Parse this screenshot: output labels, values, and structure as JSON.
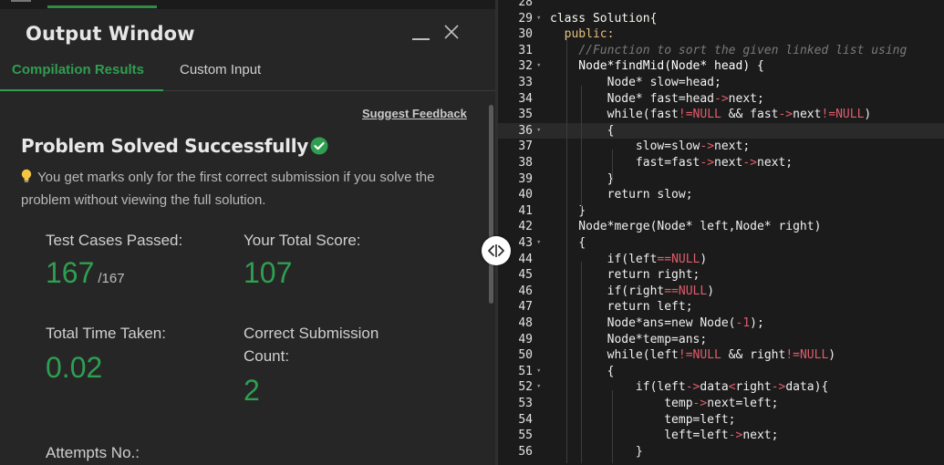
{
  "output": {
    "title": "Output Window",
    "tabs": [
      {
        "label": "Compilation Results",
        "active": true
      },
      {
        "label": "Custom Input",
        "active": false
      }
    ],
    "suggest_feedback": "Suggest Feedback",
    "status_title": "Problem Solved Successfully",
    "note": "You get marks only for the first correct submission if you solve the problem without viewing the full solution.",
    "stats": {
      "test_cases_label": "Test Cases Passed:",
      "test_cases_value": "167",
      "test_cases_total": "/167",
      "score_label": "Your Total Score:",
      "score_value": "107",
      "time_label": "Total Time Taken:",
      "time_value": "0.02",
      "submission_label": "Correct Submission Count:",
      "submission_value": "2",
      "attempts_label": "Attempts No.:"
    }
  },
  "colors": {
    "accent_green": "#2f9e51",
    "panel_bg": "#262626",
    "editor_bg": "#1b1b1b",
    "highlight_red": "#e05c6b"
  },
  "icons": [
    "menu-icon",
    "minimize-icon",
    "close-icon",
    "check-circle-icon",
    "lightbulb-icon",
    "split-handle-icon",
    "fold-arrow-icon"
  ],
  "editor": {
    "lines": [
      {
        "n": "28",
        "fold": false,
        "tokens": [
          {
            "t": "",
            "c": ""
          }
        ]
      },
      {
        "n": "29",
        "fold": true,
        "tokens": [
          {
            "t": "class Solution{",
            "c": "t-kw"
          }
        ]
      },
      {
        "n": "30",
        "fold": false,
        "tokens": [
          {
            "t": "  ",
            "c": ""
          },
          {
            "t": "public:",
            "c": "t-pub"
          }
        ]
      },
      {
        "n": "31",
        "fold": false,
        "tokens": [
          {
            "t": "    ",
            "c": ""
          },
          {
            "t": "//Function to sort the given linked list using",
            "c": "t-com"
          }
        ]
      },
      {
        "n": "32",
        "fold": true,
        "tokens": [
          {
            "t": "    Node*findMid(Node* head) {",
            "c": "t-fn"
          }
        ]
      },
      {
        "n": "33",
        "fold": false,
        "tokens": [
          {
            "t": "        Node* slow=head;",
            "c": ""
          }
        ]
      },
      {
        "n": "34",
        "fold": false,
        "tokens": [
          {
            "t": "        Node* fast=head",
            "c": ""
          },
          {
            "t": "->",
            "c": "t-op"
          },
          {
            "t": "next;",
            "c": ""
          }
        ]
      },
      {
        "n": "35",
        "fold": false,
        "tokens": [
          {
            "t": "        while(fast",
            "c": ""
          },
          {
            "t": "!=",
            "c": "t-op"
          },
          {
            "t": "NULL",
            "c": "t-null"
          },
          {
            "t": " && fast",
            "c": ""
          },
          {
            "t": "->",
            "c": "t-op"
          },
          {
            "t": "next",
            "c": ""
          },
          {
            "t": "!=",
            "c": "t-op"
          },
          {
            "t": "NULL",
            "c": "t-null"
          },
          {
            "t": ")",
            "c": ""
          }
        ]
      },
      {
        "n": "36",
        "fold": true,
        "tokens": [
          {
            "t": "        {",
            "c": ""
          }
        ]
      },
      {
        "n": "37",
        "fold": false,
        "tokens": [
          {
            "t": "            slow=slow",
            "c": ""
          },
          {
            "t": "->",
            "c": "t-op"
          },
          {
            "t": "next;",
            "c": ""
          }
        ]
      },
      {
        "n": "38",
        "fold": false,
        "tokens": [
          {
            "t": "            fast=fast",
            "c": ""
          },
          {
            "t": "->",
            "c": "t-op"
          },
          {
            "t": "next",
            "c": ""
          },
          {
            "t": "->",
            "c": "t-op"
          },
          {
            "t": "next;",
            "c": ""
          }
        ]
      },
      {
        "n": "39",
        "fold": false,
        "tokens": [
          {
            "t": "        }",
            "c": ""
          }
        ]
      },
      {
        "n": "40",
        "fold": false,
        "tokens": [
          {
            "t": "        return slow;",
            "c": ""
          }
        ]
      },
      {
        "n": "41",
        "fold": false,
        "tokens": [
          {
            "t": "    }",
            "c": ""
          }
        ]
      },
      {
        "n": "42",
        "fold": false,
        "tokens": [
          {
            "t": "    Node*merge(Node* left,Node* right)",
            "c": ""
          }
        ]
      },
      {
        "n": "43",
        "fold": true,
        "tokens": [
          {
            "t": "    {",
            "c": ""
          }
        ]
      },
      {
        "n": "44",
        "fold": false,
        "tokens": [
          {
            "t": "        if(left",
            "c": ""
          },
          {
            "t": "==",
            "c": "t-op"
          },
          {
            "t": "NULL",
            "c": "t-null"
          },
          {
            "t": ")",
            "c": ""
          }
        ]
      },
      {
        "n": "45",
        "fold": false,
        "tokens": [
          {
            "t": "        return right;",
            "c": ""
          }
        ]
      },
      {
        "n": "46",
        "fold": false,
        "tokens": [
          {
            "t": "        if(right",
            "c": ""
          },
          {
            "t": "==",
            "c": "t-op"
          },
          {
            "t": "NULL",
            "c": "t-null"
          },
          {
            "t": ")",
            "c": ""
          }
        ]
      },
      {
        "n": "47",
        "fold": false,
        "tokens": [
          {
            "t": "        return left;",
            "c": ""
          }
        ]
      },
      {
        "n": "48",
        "fold": false,
        "tokens": [
          {
            "t": "        Node*ans=new Node(",
            "c": ""
          },
          {
            "t": "-1",
            "c": "t-num"
          },
          {
            "t": ");",
            "c": ""
          }
        ]
      },
      {
        "n": "49",
        "fold": false,
        "tokens": [
          {
            "t": "        Node*temp=ans;",
            "c": ""
          }
        ]
      },
      {
        "n": "50",
        "fold": false,
        "tokens": [
          {
            "t": "        while(left",
            "c": ""
          },
          {
            "t": "!=",
            "c": "t-op"
          },
          {
            "t": "NULL",
            "c": "t-null"
          },
          {
            "t": " && right",
            "c": ""
          },
          {
            "t": "!=",
            "c": "t-op"
          },
          {
            "t": "NULL",
            "c": "t-null"
          },
          {
            "t": ")",
            "c": ""
          }
        ]
      },
      {
        "n": "51",
        "fold": true,
        "tokens": [
          {
            "t": "        {",
            "c": ""
          }
        ]
      },
      {
        "n": "52",
        "fold": true,
        "tokens": [
          {
            "t": "            if(left",
            "c": ""
          },
          {
            "t": "->",
            "c": "t-op"
          },
          {
            "t": "data",
            "c": ""
          },
          {
            "t": "<",
            "c": "t-op"
          },
          {
            "t": "right",
            "c": ""
          },
          {
            "t": "->",
            "c": "t-op"
          },
          {
            "t": "data){",
            "c": ""
          }
        ]
      },
      {
        "n": "53",
        "fold": false,
        "tokens": [
          {
            "t": "                temp",
            "c": ""
          },
          {
            "t": "->",
            "c": "t-op"
          },
          {
            "t": "next=left;",
            "c": ""
          }
        ]
      },
      {
        "n": "54",
        "fold": false,
        "tokens": [
          {
            "t": "                temp=left;",
            "c": ""
          }
        ]
      },
      {
        "n": "55",
        "fold": false,
        "tokens": [
          {
            "t": "                left=left",
            "c": ""
          },
          {
            "t": "->",
            "c": "t-op"
          },
          {
            "t": "next;",
            "c": ""
          }
        ]
      },
      {
        "n": "56",
        "fold": false,
        "tokens": [
          {
            "t": "            }",
            "c": ""
          }
        ]
      }
    ]
  }
}
